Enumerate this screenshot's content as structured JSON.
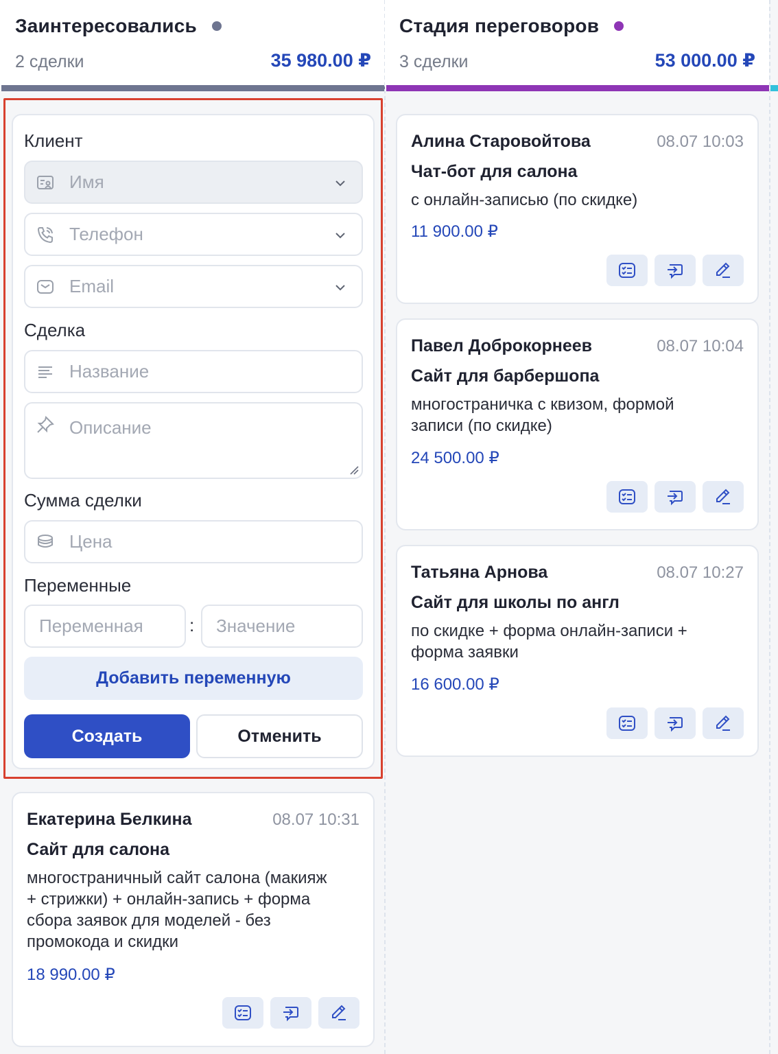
{
  "columns": [
    {
      "title": "Заинтересовались",
      "count": "2 сделки",
      "sum": "35 980.00 ₽",
      "color": "#6e7590"
    },
    {
      "title": "Стадия переговоров",
      "count": "3 сделки",
      "sum": "53 000.00 ₽",
      "color": "#8e35b5"
    }
  ],
  "form": {
    "client_label": "Клиент",
    "name_placeholder": "Имя",
    "phone_placeholder": "Телефон",
    "email_placeholder": "Email",
    "deal_label": "Сделка",
    "title_placeholder": "Название",
    "description_placeholder": "Описание",
    "amount_label": "Сумма сделки",
    "price_placeholder": "Цена",
    "variables_label": "Переменные",
    "variable_placeholder": "Переменная",
    "value_placeholder": "Значение",
    "separator": ":",
    "add_variable": "Добавить переменную",
    "create": "Создать",
    "cancel": "Отменить"
  },
  "deals_col1": [
    {
      "name": "Екатерина Белкина",
      "time": "08.07 10:31",
      "title": "Сайт для салона",
      "description": "многостраничный сайт салона (макияж + стрижки) + онлайн-запись + форма сбора заявок для моделей - без промокода и скидки",
      "price": "18 990.00 ₽"
    }
  ],
  "deals_col2": [
    {
      "name": "Алина Старовойтова",
      "time": "08.07 10:03",
      "title": "Чат-бот для салона",
      "description": "с онлайн-записью (по скидке)",
      "price": "11 900.00 ₽"
    },
    {
      "name": "Павел Доброкорнеев",
      "time": "08.07 10:04",
      "title": "Сайт для барбершопа",
      "description": "многостраничка с квизом, формой записи (по скидке)",
      "price": "24 500.00 ₽"
    },
    {
      "name": "Татьяна Арнова",
      "time": "08.07 10:27",
      "title": "Сайт для школы по англ",
      "description": "по скидке + форма онлайн-записи + форма заявки",
      "price": "16 600.00 ₽"
    }
  ],
  "colors": {
    "accent": "#2f4fc5",
    "price": "#2447b8",
    "highlight": "#d8412f",
    "next_column": "#33c1dc"
  }
}
